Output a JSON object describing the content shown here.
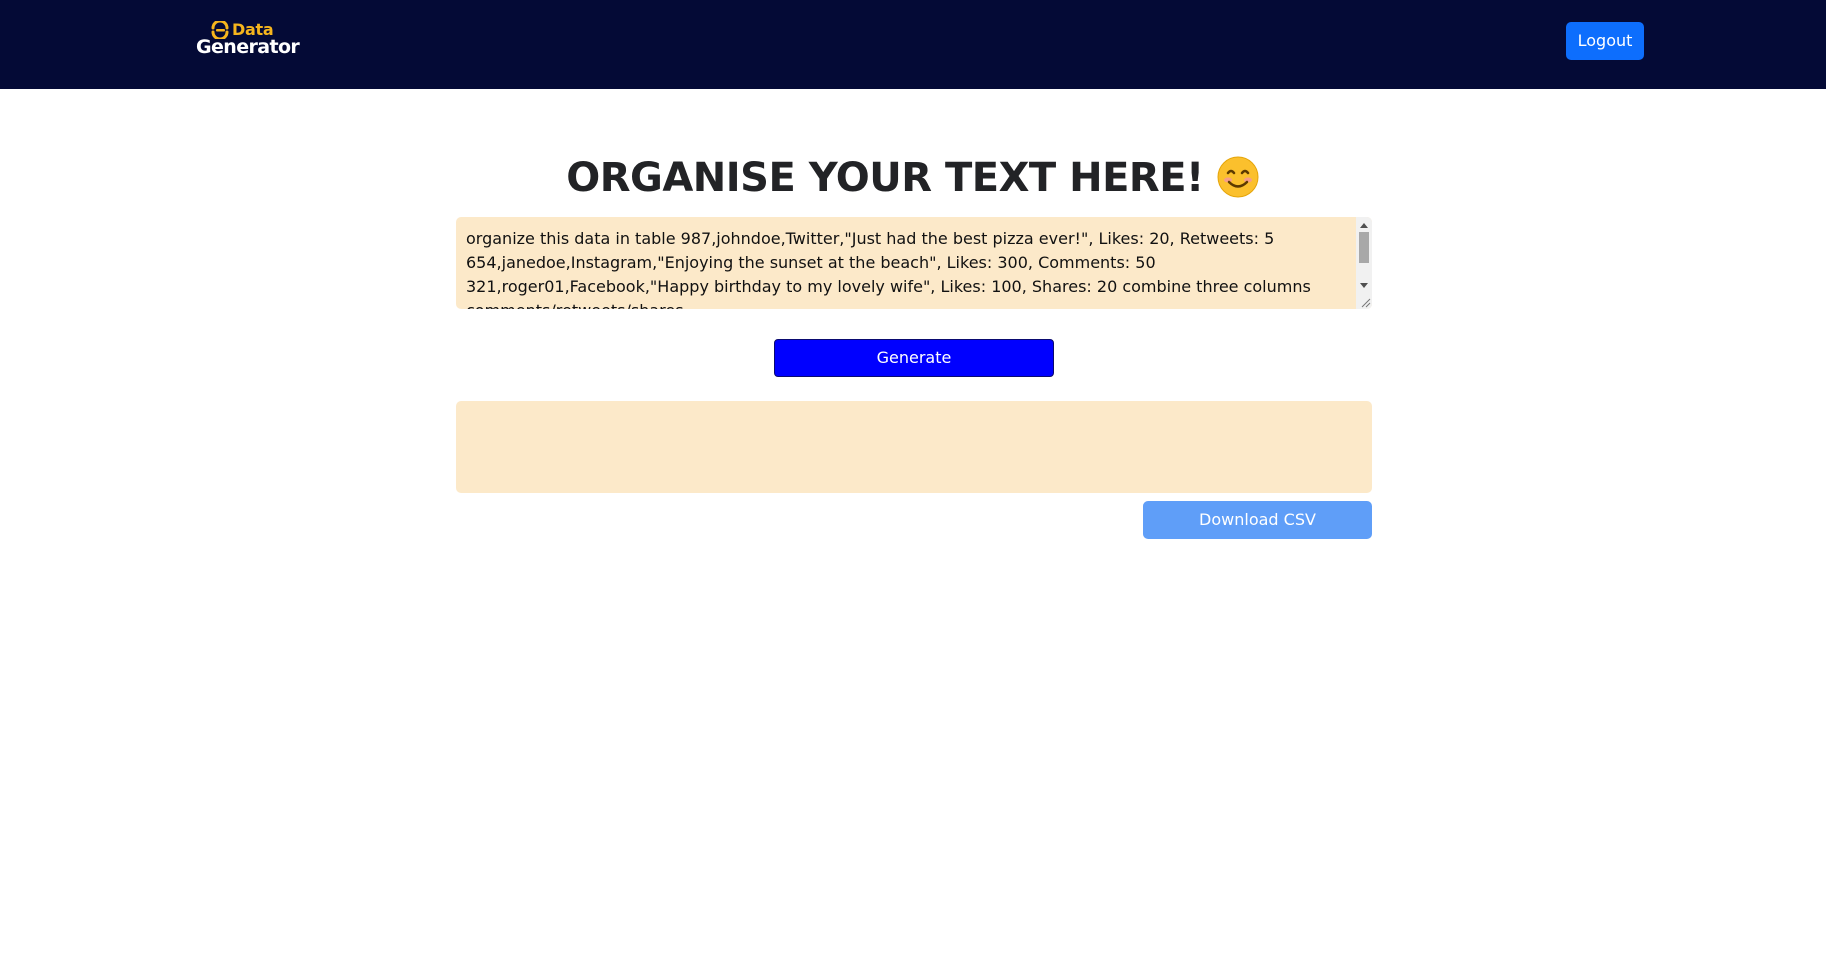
{
  "navbar": {
    "logo_line1": "Data",
    "logo_line2": "Generator",
    "logout_label": "Logout",
    "background_color": "#040a36",
    "logo_accent_color": "#f6b51d"
  },
  "main": {
    "title": "ORGANISE YOUR TEXT HERE!",
    "title_emoji": "smiling-face-emoji",
    "text_input_value": "organize this data in table 987,johndoe,Twitter,\"Just had the best pizza ever!\", Likes: 20, Retweets: 5\n654,janedoe,Instagram,\"Enjoying the sunset at the beach\", Likes: 300, Comments: 50\n321,roger01,Facebook,\"Happy birthday to my lovely wife\", Likes: 100, Shares: 20 combine three columns\ncomments/retweets/shares",
    "generate_label": "Generate",
    "output_value": "",
    "download_label": "Download CSV"
  },
  "colors": {
    "input_background": "#fce9c9",
    "generate_button": "#0000ff",
    "logout_button": "#0d6efd",
    "download_button": "#5f9ef8"
  }
}
